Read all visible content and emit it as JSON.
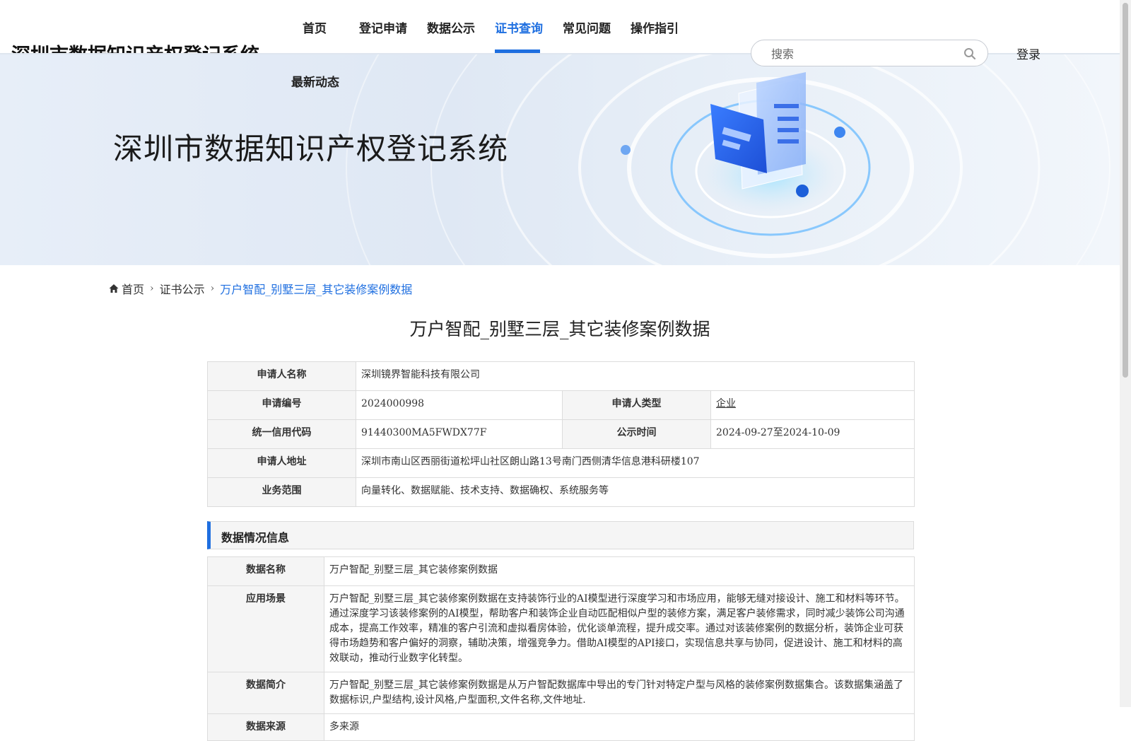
{
  "header": {
    "site_title": "深圳市数据知识产权登记系统",
    "nav": [
      "首页",
      "登记申请",
      "数据公示",
      "证书查询",
      "常见问题",
      "操作指引",
      "最新动态"
    ],
    "active_nav": "证书查询",
    "search_placeholder": "搜索",
    "login_label": "登录"
  },
  "banner": {
    "title": "深圳市数据知识产权登记系统"
  },
  "breadcrumb": {
    "home": "首页",
    "section": "证书公示",
    "current": "万户智配_别墅三层_其它装修案例数据"
  },
  "page": {
    "heading": "万户智配_别墅三层_其它装修案例数据"
  },
  "applicant": {
    "name_label": "申请人名称",
    "name": "深圳镜界智能科技有限公司",
    "number_label": "申请编号",
    "number": "2024000998",
    "type_label": "申请人类型",
    "type": "企业",
    "credit_label": "统一信用代码",
    "credit": "91440300MA5FWDX77F",
    "pub_label": "公示时间",
    "pub": "2024-09-27至2024-10-09",
    "address_label": "申请人地址",
    "address": "深圳市南山区西丽街道松坪山社区朗山路13号南门西侧清华信息港科研楼107",
    "scope_label": "业务范围",
    "scope": "向量转化、数据赋能、技术支持、数据确权、系统服务等"
  },
  "data_info": {
    "section_title": "数据情况信息",
    "rows": [
      {
        "label": "数据名称",
        "value": "万户智配_别墅三层_其它装修案例数据"
      },
      {
        "label": "应用场景",
        "value": "万户智配_别墅三层_其它装修案例数据在支持装饰行业的AI模型进行深度学习和市场应用，能够无缝对接设计、施工和材料等环节。通过深度学习该装修案例的AI模型，帮助客户和装饰企业自动匹配相似户型的装修方案，满足客户装修需求，同时减少装饰公司沟通成本，提高工作效率，精准的客户引流和虚拟看房体验，优化谈单流程，提升成交率。通过对该装修案例的数据分析，装饰企业可获得市场趋势和客户偏好的洞察，辅助决策，增强竞争力。借助AI模型的API接口，实现信息共享与协同，促进设计、施工和材料的高效联动，推动行业数字化转型。"
      },
      {
        "label": "数据简介",
        "value": "万户智配_别墅三层_其它装修案例数据是从万户智配数据库中导出的专门针对特定户型与风格的装修案例数据集合。该数据集涵盖了数据标识,户型结构,设计风格,户型面积,文件名称,文件地址."
      },
      {
        "label": "数据来源",
        "value": "多来源"
      }
    ]
  },
  "colors": {
    "accent": "#1f6fe0",
    "label_bg": "#f5f5f5",
    "border": "#dcdcdc"
  }
}
